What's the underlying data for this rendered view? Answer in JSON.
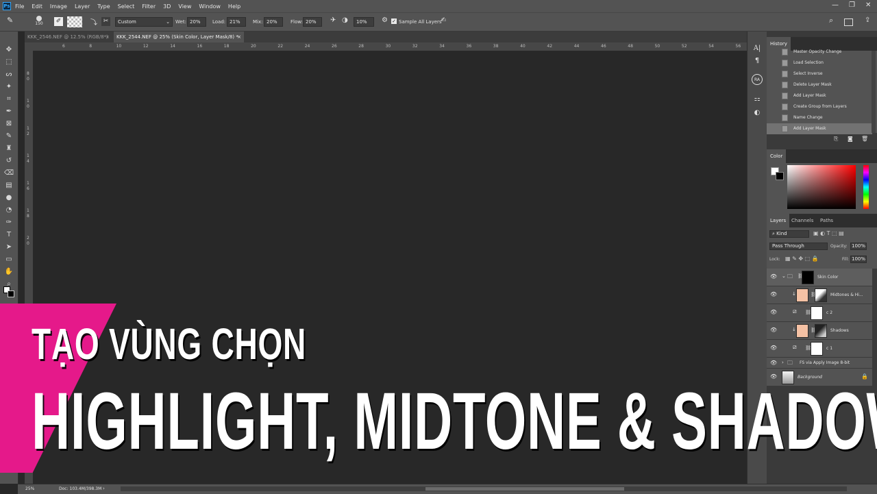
{
  "menu": {
    "app_icon": "Ps",
    "items": [
      "File",
      "Edit",
      "Image",
      "Layer",
      "Type",
      "Select",
      "Filter",
      "3D",
      "View",
      "Window",
      "Help"
    ],
    "window_controls": {
      "minimize": "—",
      "restore": "❐",
      "close": "✕"
    }
  },
  "options_bar": {
    "brush_size": "150",
    "preset": "Custom",
    "wet_label": "Wet:",
    "wet_value": "20%",
    "load_label": "Load:",
    "load_value": "21%",
    "mix_label": "Mix:",
    "mix_value": "20%",
    "flow_label": "Flow:",
    "flow_value": "20%",
    "angle_value": "10%",
    "sample_all_label": "Sample All Layers",
    "sample_all_checked": true
  },
  "document_tabs": [
    {
      "label": "KKK_2546.NEF @ 12.5% (RGB/8*)",
      "close": "×",
      "active": false
    },
    {
      "label": "KKK_2544.NEF @ 25% (Skin Color, Layer Mask/8) *",
      "close": "×",
      "active": true
    }
  ],
  "ruler": {
    "h_labels": [
      "6",
      "8",
      "10",
      "12",
      "14",
      "16",
      "18",
      "20",
      "22",
      "24",
      "26",
      "28",
      "30",
      "32",
      "34",
      "36",
      "38",
      "40",
      "42",
      "44",
      "46",
      "48",
      "50",
      "52",
      "54",
      "56"
    ],
    "v_labels": [
      "8",
      "0",
      "1",
      "0",
      "1",
      "2",
      "1",
      "4",
      "1",
      "6",
      "1",
      "8",
      "2",
      "0"
    ]
  },
  "status": {
    "zoom": "25%",
    "doc": "Doc: 103.4M/398.3M"
  },
  "history": {
    "tab": "History",
    "items": [
      "Master Opacity Change",
      "Load Selection",
      "Select Inverse",
      "Delete Layer Mask",
      "Add Layer Mask",
      "Create Group from Layers",
      "Name Change",
      "Add Layer Mask"
    ],
    "selected_index": 7
  },
  "color_panel": {
    "tab": "Color",
    "hue_color": "#ff0000"
  },
  "layers_panel": {
    "tabs": [
      "Layers",
      "Channels",
      "Paths"
    ],
    "filter_kind": "Kind",
    "blend_mode": "Pass Through",
    "opacity_label": "Opacity:",
    "opacity_value": "100%",
    "lock_label": "Lock:",
    "fill_label": "Fill:",
    "fill_value": "100%",
    "layers": [
      {
        "name": "Skin Color",
        "kind": "group"
      },
      {
        "name": "Midtones & Hi...",
        "kind": "fill"
      },
      {
        "name": "c 2",
        "kind": "adjustment"
      },
      {
        "name": "Shadows",
        "kind": "fill"
      },
      {
        "name": "c 1",
        "kind": "adjustment"
      },
      {
        "name": "FS via Apply Image 8-bit",
        "kind": "group"
      },
      {
        "name": "Background",
        "kind": "background"
      }
    ],
    "fill_swatch_color": "#f4c1a4"
  },
  "overlay": {
    "line1": "TẠO VÙNG CHỌN",
    "line2": "HIGHLIGHT, MIDTONE & SHADOW",
    "accent_color": "#e5198a"
  },
  "icons": {
    "tools": [
      "move-icon",
      "marquee-icon",
      "lasso-icon",
      "magic-wand-icon",
      "crop-icon",
      "eyedropper-icon",
      "frame-icon",
      "brush-icon",
      "stamp-icon",
      "history-brush-icon",
      "eraser-icon",
      "gradient-icon",
      "blur-icon",
      "dodge-icon",
      "pen-icon",
      "type-icon",
      "path-select-icon",
      "rectangle-icon",
      "hand-icon",
      "zoom-icon"
    ]
  }
}
